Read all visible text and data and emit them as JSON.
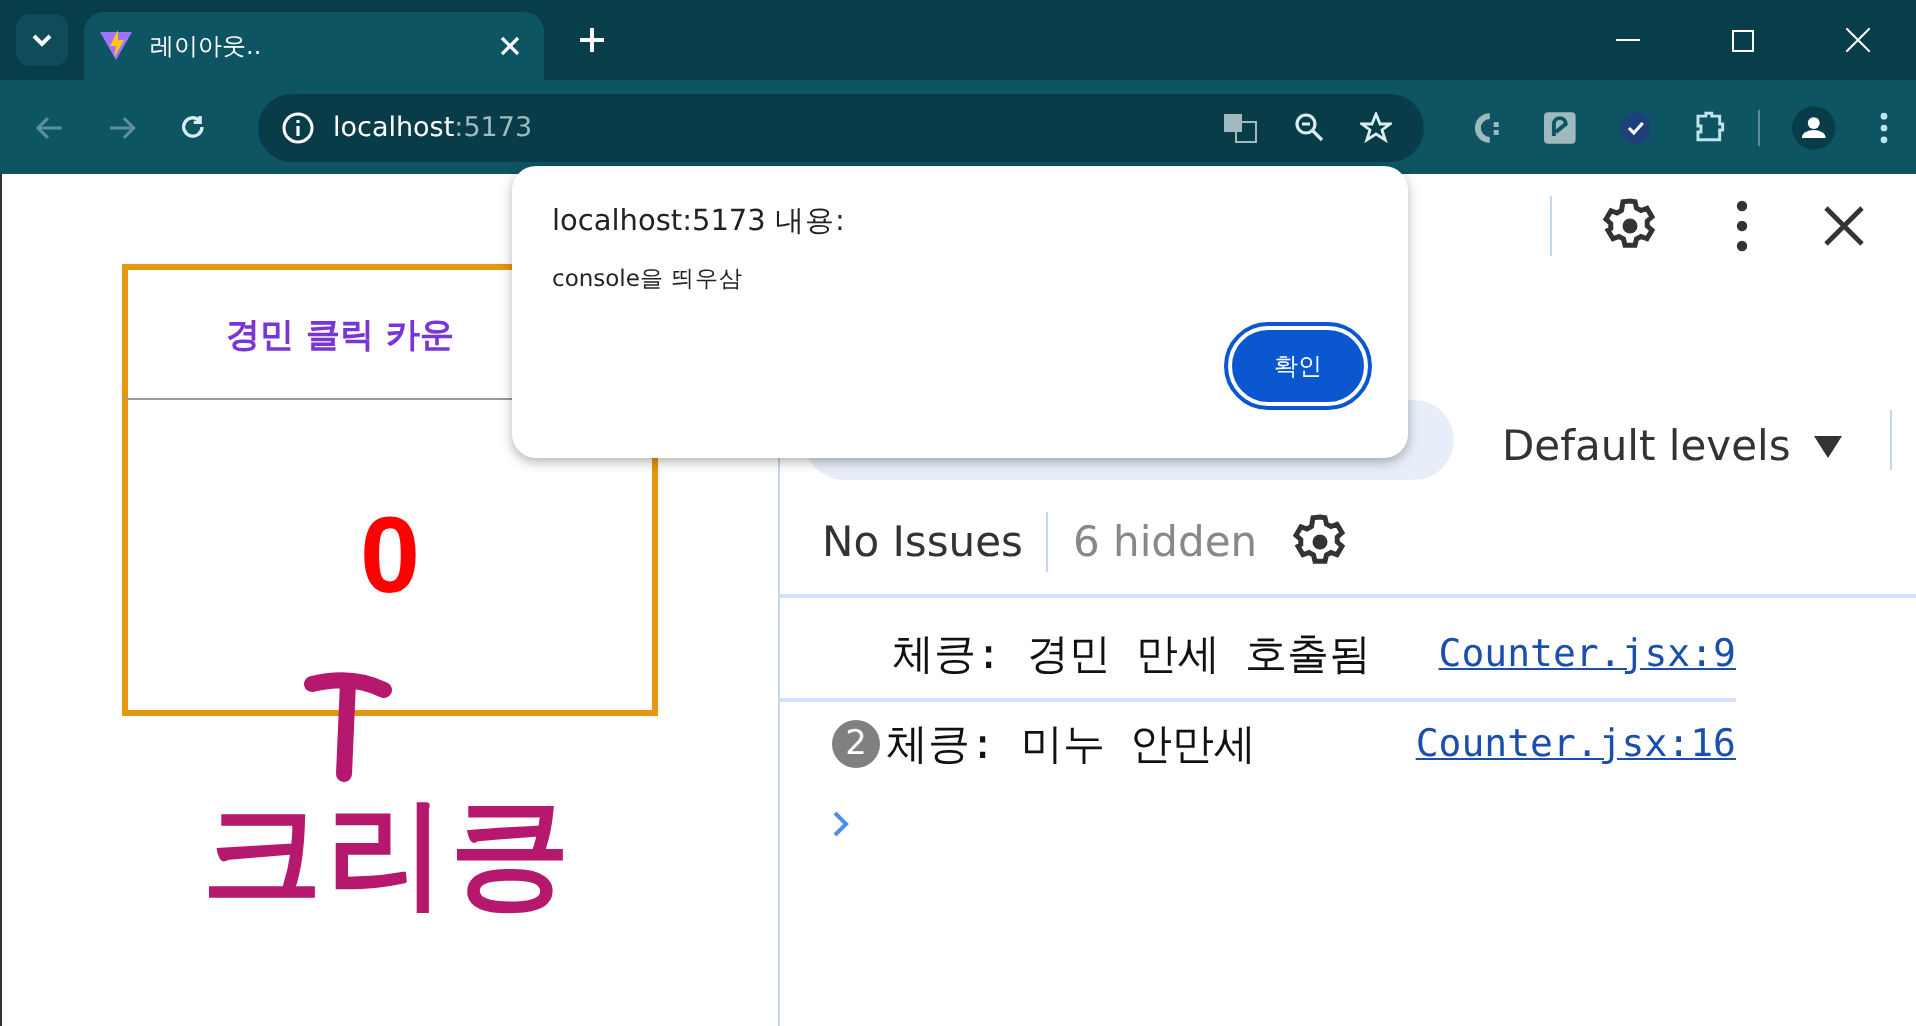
{
  "browser": {
    "tabs": [
      {
        "title": "레이아웃..",
        "selected": true
      }
    ],
    "address": {
      "host": "localhost",
      "port": ":5173"
    }
  },
  "page": {
    "counter": {
      "title": "경민 클릭 카운",
      "count": "0"
    },
    "annotation": {
      "text": "크리킁"
    }
  },
  "dialog": {
    "title": "localhost:5173 내용:",
    "message": "console을 띄우삼",
    "buttons": [
      "확인"
    ]
  },
  "devtools": {
    "levels": "Default levels",
    "issues": "No Issues",
    "hidden": "6 hidden",
    "messages": [
      {
        "text": "체킁: 경민 만세 호출됨",
        "source": "Counter.jsx:9"
      },
      {
        "count": "2",
        "text": "체킁: 미누 안만세",
        "source": "Counter.jsx:16"
      }
    ]
  }
}
